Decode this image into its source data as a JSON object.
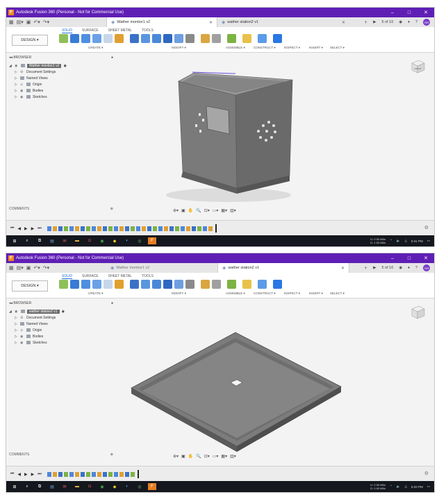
{
  "screens": [
    {
      "title_bar": "Autodesk Fusion 360 (Personal - Not for Commercial Use)",
      "tabs": [
        {
          "label": "Wather monitor1 v2",
          "active": true
        },
        {
          "label": "wather station2 v1",
          "active": false
        }
      ],
      "tab_counter": "5 of 10",
      "avatar": "AH",
      "design_button": "DESIGN ▾",
      "workspace_tabs": [
        "SOLID",
        "SURFACE",
        "SHEET METAL",
        "TOOLS"
      ],
      "toolbar_groups": [
        "CREATE ▾",
        "MODIFY ▾",
        "ASSEMBLE ▾",
        "CONSTRUCT ▾",
        "INSPECT ▾",
        "INSERT ▾",
        "SELECT ▾"
      ],
      "browser": {
        "header": "BROWSER",
        "root": "Wather monitor1 v2",
        "items": [
          "Document Settings",
          "Named Views",
          "Origin",
          "Bodies",
          "Sketches"
        ]
      },
      "comments": "COMMENTS",
      "viewcube_label": "FRONT",
      "model": "box",
      "taskbar": {
        "net_up": "0.00 kB/s",
        "net_down": "1.00 kB/s",
        "time": "5:41 PM"
      }
    },
    {
      "title_bar": "Autodesk Fusion 360 (Personal - Not for Commercial Use)",
      "tabs": [
        {
          "label": "Wather monitor1 v2",
          "active": false
        },
        {
          "label": "wather station2 v1",
          "active": true
        }
      ],
      "tab_counter": "5 of 10",
      "avatar": "AH",
      "design_button": "DESIGN ▾",
      "workspace_tabs": [
        "SOLID",
        "SURFACE",
        "SHEET METAL",
        "TOOLS"
      ],
      "toolbar_groups": [
        "CREATE ▾",
        "MODIFY ▾",
        "ASSEMBLE ▾",
        "CONSTRUCT ▾",
        "INSPECT ▾",
        "INSERT ▾",
        "SELECT ▾"
      ],
      "browser": {
        "header": "BROWSER",
        "root": "wather station2 v1",
        "items": [
          "Document Settings",
          "Named Views",
          "Origin",
          "Bodies",
          "Sketches"
        ]
      },
      "comments": "COMMENTS",
      "viewcube_label": "",
      "model": "tray",
      "taskbar": {
        "net_up": "0.00 kB/s",
        "net_down": "0.00 kB/s",
        "time": "5:42 PM"
      }
    }
  ],
  "colors": {
    "title_bar": "#5f1fb5",
    "model_face": "#767676",
    "accent": "#1d6fd6"
  }
}
